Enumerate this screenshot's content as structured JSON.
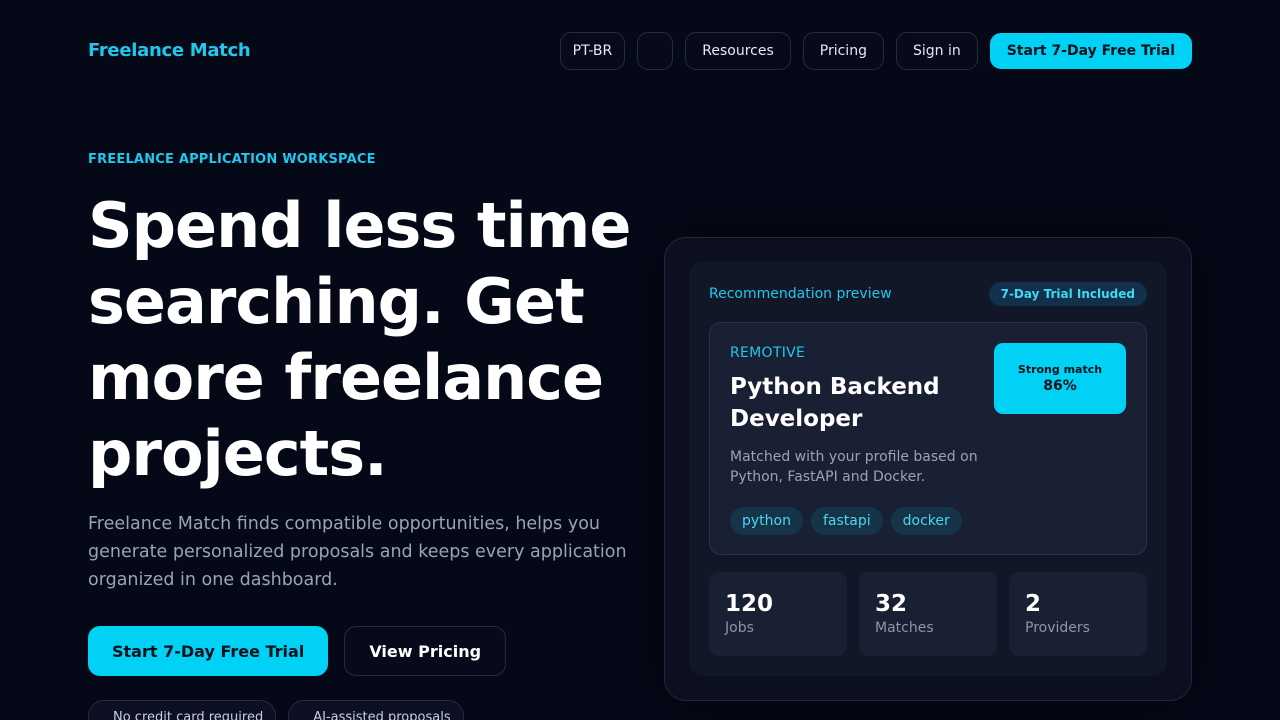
{
  "header": {
    "logo": "Freelance Match",
    "nav": {
      "lang": "PT-BR",
      "resources": "Resources",
      "pricing": "Pricing",
      "signin": "Sign in",
      "cta": "Start 7-Day Free Trial"
    }
  },
  "hero": {
    "eyebrow": "FREELANCE APPLICATION WORKSPACE",
    "headline": "Spend less time searching. Get more freelance projects.",
    "sub": "Freelance Match finds compatible opportunities, helps you generate personalized proposals and keeps every application organized in one dashboard.",
    "primary_btn": "Start 7-Day Free Trial",
    "secondary_btn": "View Pricing",
    "pills": [
      "No credit card required",
      "AI-assisted proposals"
    ]
  },
  "preview": {
    "label": "Recommendation preview",
    "badge": "7-Day Trial Included",
    "job": {
      "company": "REMOTIVE",
      "title": "Python Backend Developer",
      "match_label": "Strong match",
      "match_value": "86%",
      "description": "Matched with your profile based on Python, FastAPI and Docker.",
      "tags": [
        "python",
        "fastapi",
        "docker"
      ]
    },
    "stats": [
      {
        "value": "120",
        "label": "Jobs"
      },
      {
        "value": "32",
        "label": "Matches"
      },
      {
        "value": "2",
        "label": "Providers"
      }
    ]
  },
  "colors": {
    "background": "#050817",
    "accent": "#00d1f5",
    "card": "#121728"
  }
}
